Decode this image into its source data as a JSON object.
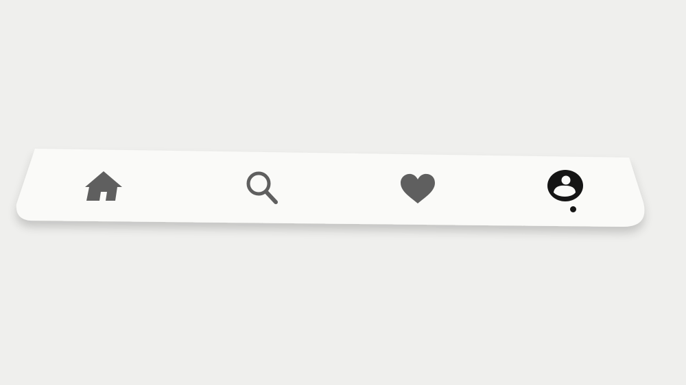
{
  "colors": {
    "page_background": "#efefed",
    "tab_bar_background": "#fafaf8",
    "inactive_icon": "#5f5f5f",
    "active_icon": "#151515"
  },
  "tab_bar": {
    "active_tab": "profile",
    "tabs": [
      {
        "id": "home",
        "icon": "home-icon",
        "active": false
      },
      {
        "id": "search",
        "icon": "search-icon",
        "active": false
      },
      {
        "id": "likes",
        "icon": "heart-icon",
        "active": false
      },
      {
        "id": "profile",
        "icon": "profile-icon",
        "active": true
      }
    ],
    "active_indicator": "dot"
  }
}
